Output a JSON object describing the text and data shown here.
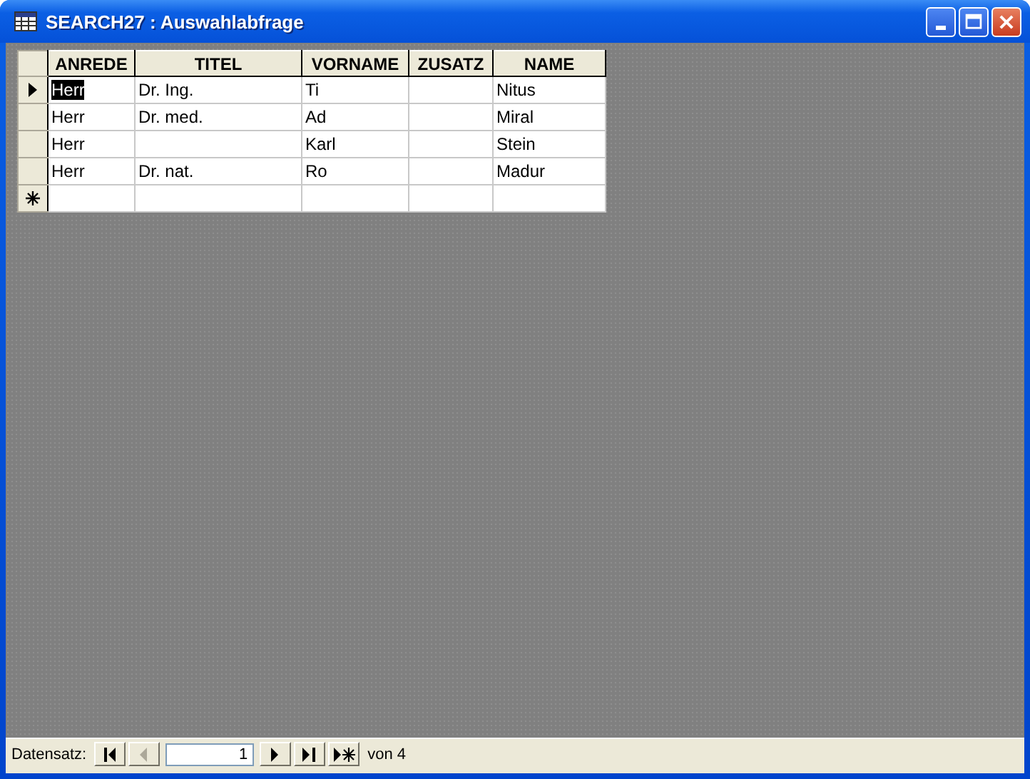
{
  "window": {
    "title": "SEARCH27 : Auswahlabfrage"
  },
  "table": {
    "columns": [
      "ANREDE",
      "TITEL",
      "VORNAME",
      "ZUSATZ",
      "NAME"
    ],
    "rows": [
      {
        "current": true,
        "cells": [
          "Herr",
          "Dr. Ing.",
          "Ti",
          "",
          "Nitus"
        ]
      },
      {
        "current": false,
        "cells": [
          "Herr",
          "Dr. med.",
          "Ad",
          "",
          "Miral"
        ]
      },
      {
        "current": false,
        "cells": [
          "Herr",
          "",
          "Karl",
          "",
          "Stein"
        ]
      },
      {
        "current": false,
        "cells": [
          "Herr",
          "Dr. nat.",
          "Ro",
          "",
          "Madur"
        ]
      }
    ]
  },
  "navigation": {
    "label": "Datensatz:",
    "record": "1",
    "total": "von 4",
    "buttons": [
      {
        "kind": "first",
        "disabled": false
      },
      {
        "kind": "prev",
        "disabled": true
      },
      {
        "kind": "next",
        "disabled": false
      },
      {
        "kind": "last",
        "disabled": false
      },
      {
        "kind": "new",
        "disabled": false
      }
    ]
  }
}
